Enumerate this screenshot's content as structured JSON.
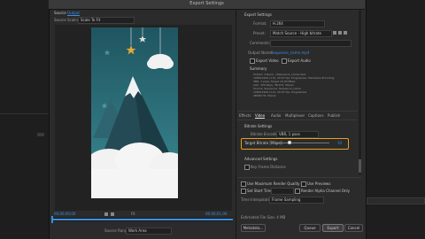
{
  "dialog": {
    "title": "Export Settings"
  },
  "source_tabs": {
    "source": "Source",
    "output": "Output"
  },
  "source_scaling": {
    "label": "Source Scaling:",
    "value": "Scale To Fit"
  },
  "export_settings": {
    "header": "Export Settings",
    "format_label": "Format:",
    "format_value": "H.264",
    "preset_label": "Preset:",
    "preset_value": "Match Source - High bitrate",
    "comments_label": "Comments:",
    "output_name_label": "Output Name:",
    "output_name_value": "Sequence_name.mp4",
    "export_video_label": "Export Video",
    "export_audio_label": "Export Audio",
    "summary_header": "Summary",
    "summary_output": "Output: /Users/.../Sequence_name.mp4",
    "summary_output_2": "1080x1920 (1.0), 29.97 fps, Progressive, Hardware Encoding",
    "summary_output_3": "VBR, 1 pass, Target 10.00 Mbps",
    "summary_output_4": "AAC, 320 kbps, 48 kHz, Stereo",
    "summary_source": "Source: Sequence, Sequence_name",
    "summary_source_2": "1080x1920 (1.0), 29.97 fps, Progressive",
    "summary_source_3": "48000 Hz, Stereo"
  },
  "tabs": [
    "Effects",
    "Video",
    "Audio",
    "Multiplexer",
    "Captions",
    "Publish"
  ],
  "active_tab_index": 1,
  "bitrate": {
    "header": "Bitrate Settings",
    "encoding_label": "Bitrate Encoding:",
    "encoding_value": "VBR, 1 pass",
    "target_label": "Target Bitrate [Mbps]:",
    "target_value": "10",
    "target_fraction": 0.25
  },
  "advanced": {
    "header": "Advanced Settings",
    "key_frame_label": "Key Frame Distance"
  },
  "options": {
    "max_render_quality": "Use Maximum Render Quality",
    "use_previews": "Use Previews",
    "set_start_timecode": "Set Start Timecode",
    "render_alpha": "Render Alpha Channel Only",
    "time_interpolation_label": "Time Interpolation:",
    "time_interpolation_value": "Frame Sampling"
  },
  "file_size": "Estimated File Size: 4 MB",
  "buttons": {
    "metadata": "Metadata...",
    "queue": "Queue",
    "export": "Export",
    "cancel": "Cancel"
  },
  "timeline": {
    "in_timecode": "00;00;00;00",
    "out_timecode": "00;00;01;00",
    "fit_label": "Fit",
    "source_range_label": "Source Range:",
    "source_range_value": "Work Area"
  },
  "colors": {
    "highlight": "#e6a020",
    "accent_blue": "#3a8fe0",
    "sky": "#2d6e7a",
    "cloud": "#f2f2f2"
  }
}
